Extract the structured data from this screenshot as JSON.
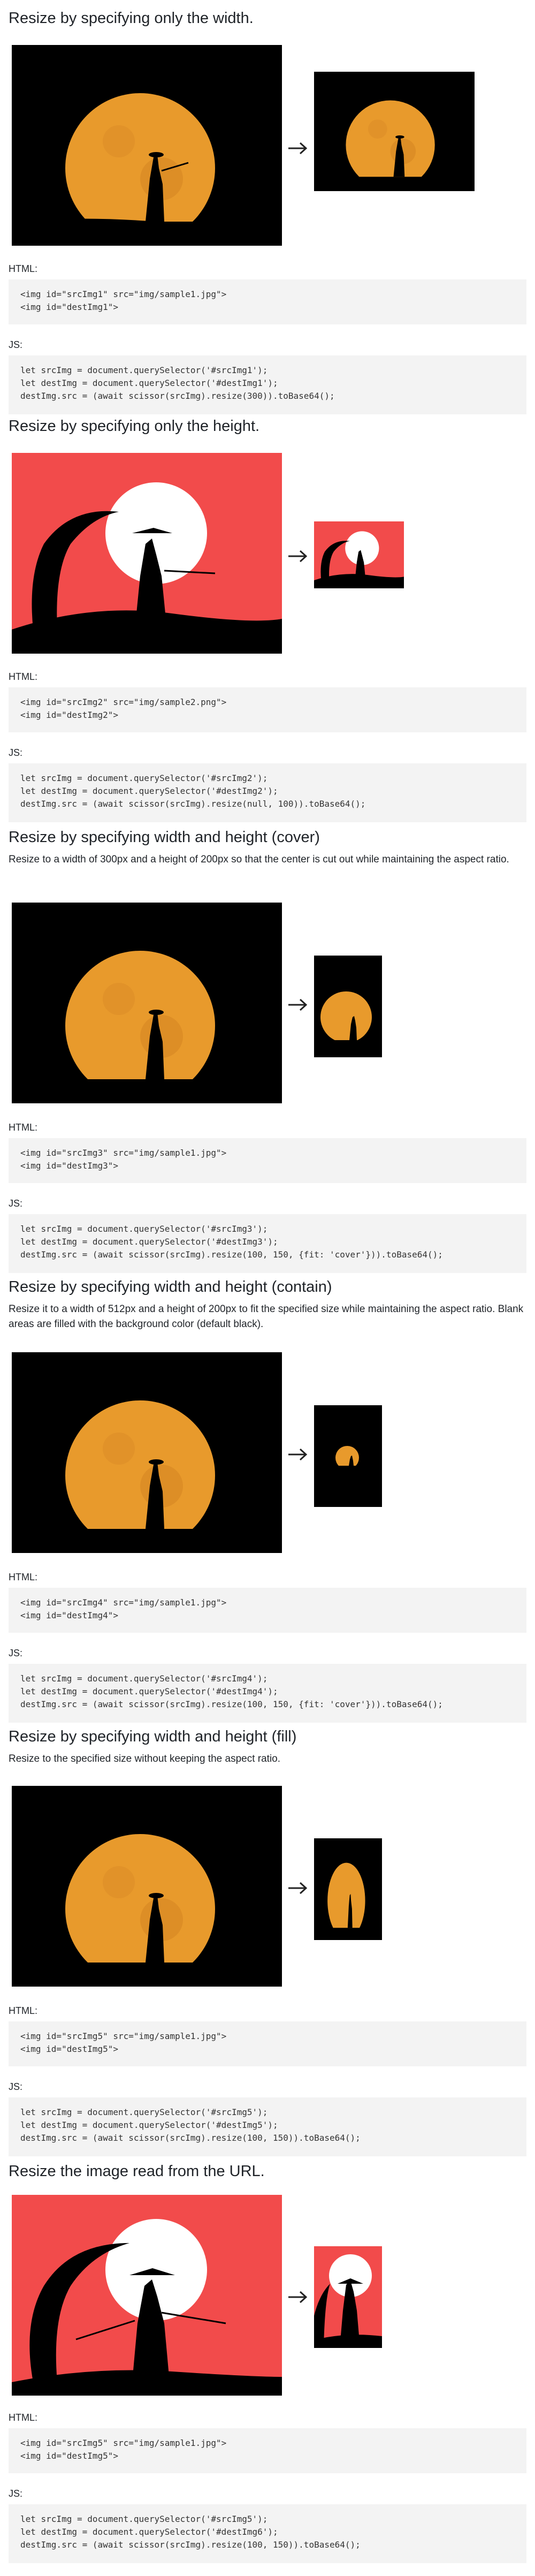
{
  "sections": [
    {
      "title": "Resize by specifying only the width.",
      "description": "",
      "html_label": "HTML:",
      "js_label": "JS:",
      "html_lines": [
        "<img id=\"srcImg1\" src=\"img/sample1.jpg\">",
        "<img id=\"destImg1\">"
      ],
      "js_lines": [
        "let srcImg = document.querySelector('#srcImg1');",
        "let destImg = document.querySelector('#destImg1');",
        "destImg.src = (await scissor(srcImg).resize(300)).toBase64();"
      ]
    },
    {
      "title": "Resize by specifying only the height.",
      "description": "",
      "html_label": "HTML:",
      "js_label": "JS:",
      "html_lines": [
        "<img id=\"srcImg2\" src=\"img/sample2.png\">",
        "<img id=\"destImg2\">"
      ],
      "js_lines": [
        "let srcImg = document.querySelector('#srcImg2');",
        "let destImg = document.querySelector('#destImg2');",
        "destImg.src = (await scissor(srcImg).resize(null, 100)).toBase64();"
      ]
    },
    {
      "title": "Resize by specifying width and height (cover)",
      "description": "Resize to a width of 300px and a height of 200px so that the center is cut out while maintaining the aspect ratio.",
      "html_label": "HTML:",
      "js_label": "JS:",
      "html_lines": [
        "<img id=\"srcImg3\" src=\"img/sample1.jpg\">",
        "<img id=\"destImg3\">"
      ],
      "js_lines": [
        "let srcImg = document.querySelector('#srcImg3');",
        "let destImg = document.querySelector('#destImg3');",
        "destImg.src = (await scissor(srcImg).resize(100, 150, {fit: 'cover'})).toBase64();"
      ]
    },
    {
      "title": "Resize by specifying width and height (contain)",
      "description": "Resize it to a width of 512px and a height of 200px to fit the specified size while maintaining the aspect ratio. Blank areas are filled with the background color (default black).",
      "html_label": "HTML:",
      "js_label": "JS:",
      "html_lines": [
        "<img id=\"srcImg4\" src=\"img/sample1.jpg\">",
        "<img id=\"destImg4\">"
      ],
      "js_lines": [
        "let srcImg = document.querySelector('#srcImg4');",
        "let destImg = document.querySelector('#destImg4');",
        "destImg.src = (await scissor(srcImg).resize(100, 150, {fit: 'cover'})).toBase64();"
      ]
    },
    {
      "title": "Resize by specifying width and height (fill)",
      "description": "Resize to the specified size without keeping the aspect ratio.",
      "html_label": "HTML:",
      "js_label": "JS:",
      "html_lines": [
        "<img id=\"srcImg5\" src=\"img/sample1.jpg\">",
        "<img id=\"destImg5\">"
      ],
      "js_lines": [
        "let srcImg = document.querySelector('#srcImg5');",
        "let destImg = document.querySelector('#destImg5');",
        "destImg.src = (await scissor(srcImg).resize(100, 150)).toBase64();"
      ]
    },
    {
      "title": "Resize the image read from the URL.",
      "description": "",
      "html_label": "HTML:",
      "js_label": "JS:",
      "html_lines": [
        "<img id=\"srcImg5\" src=\"img/sample1.jpg\">",
        "<img id=\"destImg5\">"
      ],
      "js_lines": [
        "let srcImg = document.querySelector('#srcImg5');",
        "let destImg = document.querySelector('#destImg6');",
        "destImg.src = (await scissor(srcImg).resize(100, 150)).toBase64();"
      ]
    }
  ],
  "icons": {
    "arrow": "arrow-right-icon",
    "moon_scene": "moon-samurai-image",
    "sunset_scene": "sunset-samurai-image"
  },
  "colors": {
    "moon": "#e89a2c",
    "sunset_bg": "#f24b4b",
    "night_bg": "#000000",
    "code_bg": "#f3f3f3"
  }
}
